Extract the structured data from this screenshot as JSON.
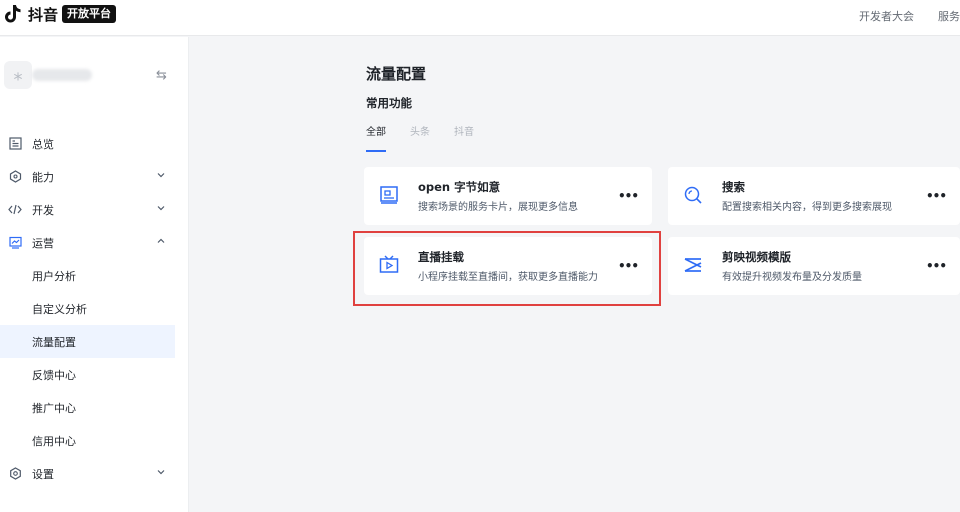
{
  "header": {
    "logo_text": "抖音",
    "logo_badge": "开放平台",
    "links": [
      "开发者大会",
      "服务"
    ]
  },
  "sidebar": {
    "app_avatar_glyph": "⁎",
    "swap_glyph": "⇆",
    "items": [
      {
        "label": "总览",
        "icon": "dashboard-icon"
      },
      {
        "label": "能力",
        "icon": "capability-icon"
      },
      {
        "label": "开发",
        "icon": "code-icon"
      },
      {
        "label": "运营",
        "icon": "operation-icon"
      },
      {
        "label": "设置",
        "icon": "settings-icon"
      }
    ],
    "sub_items": [
      "用户分析",
      "自定义分析",
      "流量配置",
      "反馈中心",
      "推广中心",
      "信用中心"
    ],
    "active_sub": "流量配置"
  },
  "main": {
    "page_title": "流量配置",
    "section_title": "常用功能",
    "tabs": [
      "全部",
      "头条",
      "抖音"
    ],
    "active_tab": "全部",
    "cards": [
      {
        "title": "open 字节如意",
        "desc": "搜索场景的服务卡片，展现更多信息",
        "icon": "card-display-icon",
        "more": "•••"
      },
      {
        "title": "搜索",
        "desc": "配置搜索相关内容，得到更多搜索展现",
        "icon": "search-icon",
        "more": "•••"
      },
      {
        "title": "直播挂载",
        "desc": "小程序挂载至直播间，获取更多直播能力",
        "icon": "live-tv-icon",
        "more": "•••"
      },
      {
        "title": "剪映视频模版",
        "desc": "有效提升视频发布量及分发质量",
        "icon": "capcut-icon",
        "more": "•••"
      }
    ]
  },
  "colors": {
    "accent": "#2f6cf6",
    "highlight": "#e0413f",
    "background": "#f4f5f7"
  }
}
